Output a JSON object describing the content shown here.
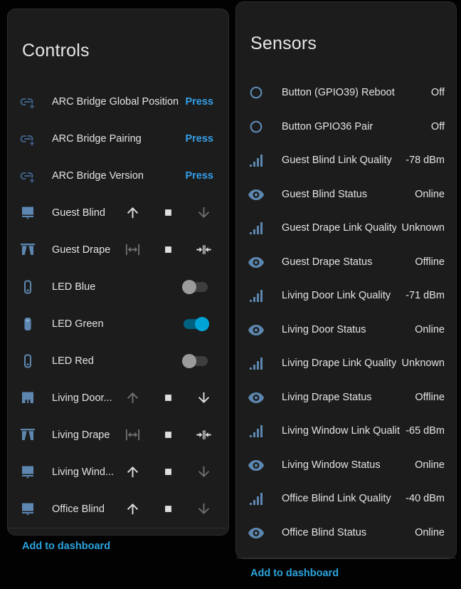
{
  "colors": {
    "page_background": "#020202",
    "card_background": "#1c1c1c",
    "card_border": "#2d2d2d",
    "text_primary": "#e3e3e3",
    "icon_blue": "#5d87b0",
    "icon_blue_dim": "#3f6189",
    "accent_press": "#359fe8",
    "accent_link": "#2ba3dc",
    "control_enabled": "#dfdfdf",
    "control_disabled": "#6e6e6e",
    "toggle_on_thumb": "#00a4d6",
    "toggle_on_track": "#00617f",
    "toggle_off_thumb": "#9b9b9b",
    "toggle_off_track": "#3e3e3e",
    "divider": "#2f2f2f"
  },
  "controls_card": {
    "title": "Controls",
    "rows": [
      {
        "icon": "link-plus",
        "label": "ARC Bridge Global Position",
        "control": "press",
        "action": "Press"
      },
      {
        "icon": "link-plus",
        "label": "ARC Bridge Pairing",
        "control": "press",
        "action": "Press"
      },
      {
        "icon": "link-plus",
        "label": "ARC Bridge Version",
        "control": "press",
        "action": "Press"
      },
      {
        "icon": "roller-shade",
        "label": "Guest Blind",
        "control": "cover-vertical",
        "up_enabled": true,
        "stop_enabled": true,
        "down_enabled": false
      },
      {
        "icon": "curtains",
        "label": "Guest Drape",
        "control": "cover-horizontal",
        "open_enabled": false,
        "stop_enabled": true,
        "close_enabled": true
      },
      {
        "icon": "led-outline",
        "label": "LED Blue",
        "control": "toggle",
        "state": "off"
      },
      {
        "icon": "led-filled",
        "label": "LED Green",
        "control": "toggle",
        "state": "on"
      },
      {
        "icon": "led-outline",
        "label": "LED Red",
        "control": "toggle",
        "state": "off"
      },
      {
        "icon": "door-shade",
        "label": "Living Door...",
        "control": "cover-vertical",
        "up_enabled": false,
        "stop_enabled": true,
        "down_enabled": true
      },
      {
        "icon": "curtains",
        "label": "Living Drape",
        "control": "cover-horizontal",
        "open_enabled": false,
        "stop_enabled": true,
        "close_enabled": true
      },
      {
        "icon": "roller-shade",
        "label": "Living Wind...",
        "control": "cover-vertical",
        "up_enabled": true,
        "stop_enabled": true,
        "down_enabled": false
      },
      {
        "icon": "roller-shade",
        "label": "Office Blind",
        "control": "cover-vertical",
        "up_enabled": true,
        "stop_enabled": true,
        "down_enabled": false
      }
    ],
    "footer_link": "Add to dashboard"
  },
  "sensors_card": {
    "title": "Sensors",
    "rows": [
      {
        "icon": "circle-outline",
        "label": "Button (GPIO39) Reboot",
        "value": "Off"
      },
      {
        "icon": "circle-outline",
        "label": "Button GPIO36 Pair",
        "value": "Off"
      },
      {
        "icon": "signal-strength",
        "label": "Guest Blind Link Quality",
        "value": "-78 dBm"
      },
      {
        "icon": "eye",
        "label": "Guest Blind Status",
        "value": "Online"
      },
      {
        "icon": "signal-strength",
        "label": "Guest Drape Link Quality",
        "value": "Unknown"
      },
      {
        "icon": "eye",
        "label": "Guest Drape Status",
        "value": "Offline"
      },
      {
        "icon": "signal-strength",
        "label": "Living Door Link Quality",
        "value": "-71 dBm"
      },
      {
        "icon": "eye",
        "label": "Living Door Status",
        "value": "Online"
      },
      {
        "icon": "signal-strength",
        "label": "Living Drape Link Quality",
        "value": "Unknown"
      },
      {
        "icon": "eye",
        "label": "Living Drape Status",
        "value": "Offline"
      },
      {
        "icon": "signal-strength",
        "label": "Living Window Link Quality",
        "value": "-65 dBm"
      },
      {
        "icon": "eye",
        "label": "Living Window Status",
        "value": "Online"
      },
      {
        "icon": "signal-strength",
        "label": "Office Blind Link Quality",
        "value": "-40 dBm"
      },
      {
        "icon": "eye",
        "label": "Office Blind Status",
        "value": "Online"
      }
    ],
    "footer_link": "Add to dashboard"
  }
}
